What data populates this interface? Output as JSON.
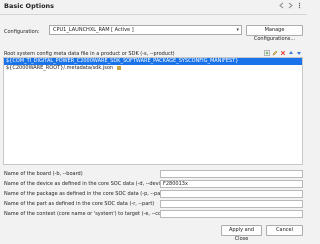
{
  "header": {
    "title": "Basic Options"
  },
  "configuration": {
    "label": "Configuration:",
    "selected": "CPU1_LAUNCHXL_RAM  [ Active ]",
    "manage_label": "Manage Configurations..."
  },
  "product_list": {
    "label": "Root system config meta data file in a product or SDK (-s, --product)",
    "items": [
      {
        "text": "${COM_TI_DIGITAL_POWER_C2000WARE_SDK_SOFTWARE_PACKAGE_SYSCONFIG_MANIFEST}",
        "selected": true
      },
      {
        "text": "${C2000WARE_ROOT}/.metadata/sdk.json",
        "selected": false
      }
    ]
  },
  "fields": [
    {
      "label": "Name of the board (-b, --board)",
      "value": ""
    },
    {
      "label": "Name of the device as defined in the core SOC data (-d, --device)",
      "value": "F280013x"
    },
    {
      "label": "Name of the package as defined in the core SOC data (-p, --package)",
      "value": ""
    },
    {
      "label": "Name of the part as defined in the core SOC data (-r, --part)",
      "value": ""
    },
    {
      "label": "Name of the context (core name or 'system') to target (-e, --context)",
      "value": ""
    }
  ],
  "footer": {
    "apply_label": "Apply and Close",
    "cancel_label": "Cancel"
  },
  "colors": {
    "selection": "#1a73e8",
    "window": "#f2f2f2"
  },
  "icons": [
    "back-icon",
    "forward-icon",
    "menu-icon",
    "add-icon",
    "edit-icon",
    "delete-icon",
    "move-up-icon",
    "move-down-icon",
    "file-icon"
  ]
}
